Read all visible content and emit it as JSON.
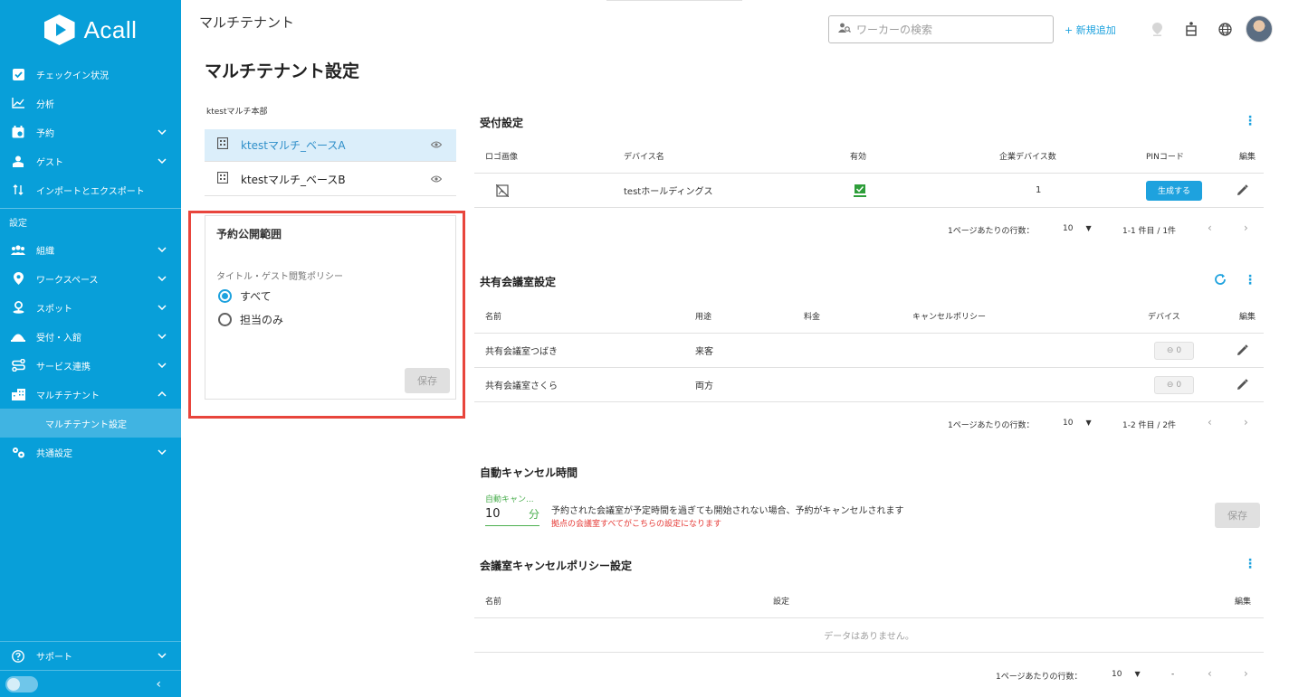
{
  "sidebar": {
    "logo_text": "Acall",
    "items": [
      {
        "label": "チェックイン状況",
        "icon": "checkbox-icon"
      },
      {
        "label": "分析",
        "icon": "chart-icon"
      },
      {
        "label": "予約",
        "icon": "calendar-icon",
        "chevron": "⌄"
      },
      {
        "label": "ゲスト",
        "icon": "guest-icon",
        "chevron": "⌄"
      },
      {
        "label": "インポートとエクスポート",
        "icon": "import-export-icon"
      }
    ],
    "section_label": "設定",
    "settings_items": [
      {
        "label": "組織",
        "icon": "people-icon"
      },
      {
        "label": "ワークスペース",
        "icon": "location-pin-icon"
      },
      {
        "label": "スポット",
        "icon": "spot-icon"
      },
      {
        "label": "受付・入館",
        "icon": "reception-icon"
      },
      {
        "label": "サービス連携",
        "icon": "integration-icon"
      },
      {
        "label": "マルチテナント",
        "icon": "building-icon"
      }
    ],
    "sub_item": "マルチテナント設定",
    "common": "共通設定",
    "support": "サポート",
    "collapse": "‹"
  },
  "header": {
    "title": "マルチテナント",
    "search_placeholder": "ワーカーの検索",
    "add_new": "+ 新規追加"
  },
  "page_title": "マルチテナント設定",
  "tenant_panel": {
    "group": "ktestマルチ本部",
    "tenants": [
      "ktestマルチ_ベースA",
      "ktestマルチ_ベースB"
    ],
    "publish": {
      "title": "予約公開範囲",
      "subtitle": "タイトル・ゲスト閲覧ポリシー",
      "options": [
        "すべて",
        "担当のみ"
      ],
      "selected": 0,
      "save": "保存"
    }
  },
  "reception": {
    "title": "受付設定",
    "headers": [
      "ロゴ画像",
      "デバイス名",
      "有効",
      "企業デバイス数",
      "PINコード",
      "編集"
    ],
    "rows": [
      {
        "device": "testホールディングス",
        "count": "1",
        "pin_button": "生成する"
      }
    ],
    "pager": {
      "label": "1ページあたりの行数：",
      "per_page": "10",
      "range": "1-1 件目 / 1件"
    }
  },
  "shared_rooms": {
    "title": "共有会議室設定",
    "headers": [
      "名前",
      "用途",
      "料金",
      "キャンセルポリシー",
      "デバイス",
      "編集"
    ],
    "rows": [
      {
        "name": "共有会議室つばき",
        "use": "来客",
        "devices": "0"
      },
      {
        "name": "共有会議室さくら",
        "use": "両方",
        "devices": "0"
      }
    ],
    "pager": {
      "label": "1ページあたりの行数：",
      "per_page": "10",
      "range": "1-2 件目 / 2件"
    }
  },
  "auto_cancel": {
    "title": "自動キャンセル時間",
    "field_label": "自動キャン...",
    "value": "10",
    "unit": "分",
    "description": "予約された会議室が予定時間を過ぎても開始されない場合、予約がキャンセルされます",
    "warning": "拠点の会議室すべてがこちらの設定になります",
    "save": "保存"
  },
  "cancel_policy": {
    "title": "会議室キャンセルポリシー設定",
    "headers": [
      "名前",
      "設定",
      "編集"
    ],
    "empty": "データはありません。",
    "pager": {
      "label": "1ページあたりの行数：",
      "per_page": "10",
      "range": "-"
    }
  },
  "colors": {
    "sidebar": "#089fd9",
    "accent": "#1ea2de",
    "highlight": "#e8453c",
    "success": "#4caf50"
  }
}
